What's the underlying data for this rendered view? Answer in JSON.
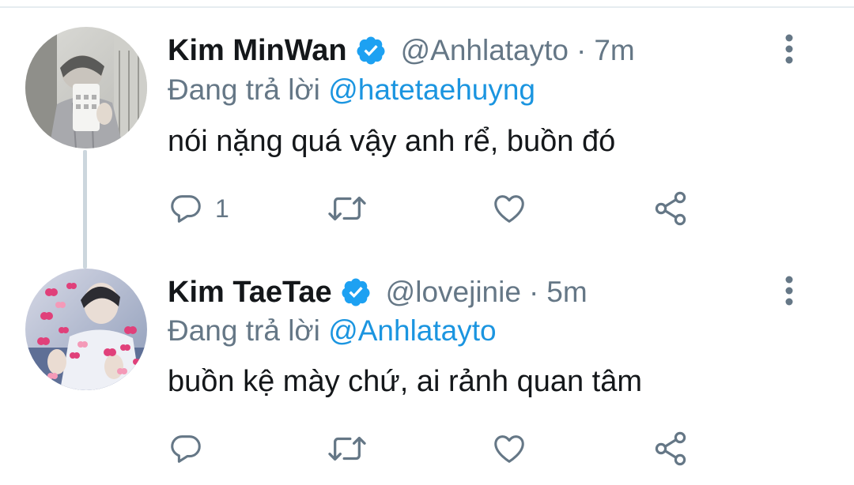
{
  "tweets": [
    {
      "name": "Kim MinWan",
      "handle": "@Anhlatayto",
      "separator": "·",
      "time": "7m",
      "replying_prefix": "Đang trả lời",
      "replying_to": "@hatetaehuyng",
      "text": "nói nặng quá vậy anh rể, buồn đó",
      "reply_count": "1",
      "avatar_icon": "profile-photo-mirror-selfie",
      "verified_icon": "verified-badge-icon"
    },
    {
      "name": "Kim TaeTae",
      "handle": "@lovejinie",
      "separator": "·",
      "time": "5m",
      "replying_prefix": "Đang trả lời",
      "replying_to": "@Anhlatayto",
      "text": "buồn kệ mày chứ, ai rảnh quan tâm",
      "reply_count": "",
      "avatar_icon": "profile-photo-hearts",
      "verified_icon": "verified-badge-icon"
    }
  ],
  "colors": {
    "text_primary": "#14171a",
    "text_secondary": "#657786",
    "link": "#1b95e0",
    "verified": "#1da1f2",
    "thread_line": "#ccd6dd"
  }
}
